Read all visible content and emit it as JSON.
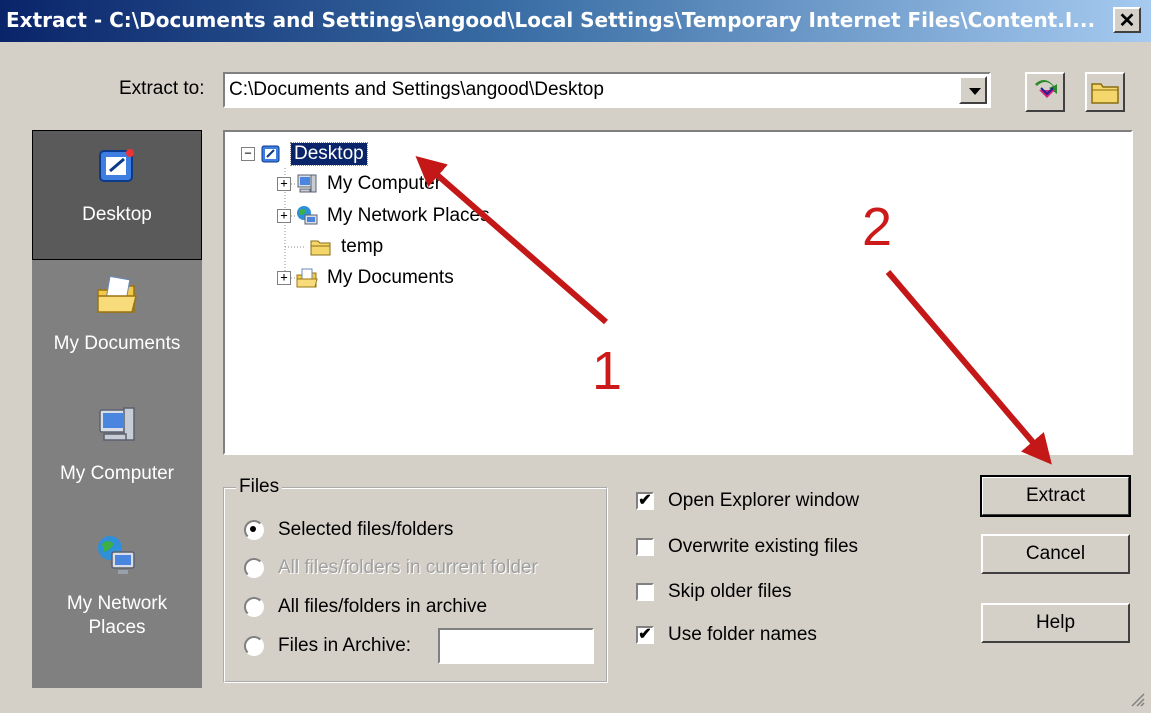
{
  "window": {
    "title": "Extract - C:\\Documents and Settings\\angood\\Local Settings\\Temporary Internet Files\\Content.I...",
    "close_glyph": "✕"
  },
  "extract_to": {
    "label": "Extract to:",
    "value": "C:\\Documents and Settings\\angood\\Desktop"
  },
  "sidebar": {
    "items": [
      {
        "label": "Desktop",
        "icon": "desktop-icon",
        "active": true
      },
      {
        "label": "My Documents",
        "icon": "my-documents-icon"
      },
      {
        "label": "My Computer",
        "icon": "my-computer-icon"
      },
      {
        "label": "My Network Places",
        "label_line1": "My Network",
        "label_line2": "Places",
        "icon": "network-places-icon"
      }
    ]
  },
  "tree": {
    "root": {
      "label": "Desktop",
      "icon": "desktop-icon",
      "expander": "⊟"
    },
    "children": [
      {
        "label": "My Computer",
        "icon": "my-computer-icon",
        "expander": "+"
      },
      {
        "label": "My Network Places",
        "icon": "network-places-icon",
        "expander": "+"
      },
      {
        "label": "temp",
        "icon": "folder-icon"
      },
      {
        "label": "My Documents",
        "icon": "my-documents-icon",
        "expander": "+"
      }
    ]
  },
  "files_group": {
    "title": "Files",
    "options": [
      {
        "label": "Selected files/folders",
        "selected": true,
        "enabled": true
      },
      {
        "label": "All files/folders in current folder",
        "selected": false,
        "enabled": false
      },
      {
        "label": "All files/folders in archive",
        "selected": false,
        "enabled": true
      },
      {
        "label": "Files in Archive:",
        "selected": false,
        "enabled": true
      }
    ],
    "files_in_archive_value": ""
  },
  "options": [
    {
      "label": "Open Explorer window",
      "checked": true
    },
    {
      "label": "Overwrite existing files",
      "checked": false
    },
    {
      "label": "Skip older files",
      "checked": false
    },
    {
      "label": "Use folder names",
      "checked": true
    }
  ],
  "check_glyph": "✔",
  "buttons": {
    "extract": "Extract",
    "cancel": "Cancel",
    "help": "Help"
  },
  "annotations": {
    "one": "1",
    "two": "2",
    "color": "#cc1a1a"
  }
}
